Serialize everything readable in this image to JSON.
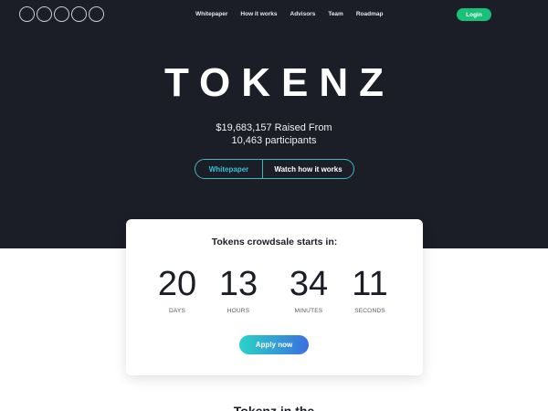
{
  "header": {
    "logo_icon": "five-circles-logo",
    "nav": [
      "Whitepaper",
      "How it works",
      "Advisors",
      "Team",
      "Roadmap"
    ],
    "login_label": "Login"
  },
  "hero": {
    "title": "TOKENZ",
    "raised_line1": "$19,683,157 Raised From",
    "raised_line2": "10,463 participants",
    "cta_whitepaper": "Whitepaper",
    "cta_watch": "Watch how it works"
  },
  "countdown": {
    "title": "Tokens crowdsale starts in:",
    "days": "20",
    "days_label": "DAYS",
    "hours": "13",
    "hours_label": "HOURS",
    "minutes": "34",
    "minutes_label": "MINUTES",
    "seconds": "11",
    "seconds_label": "SECONDS",
    "apply_label": "Apply now"
  },
  "next_section": {
    "heading": "Tokenz in the"
  },
  "colors": {
    "hero_bg": "#1b1d27",
    "login_green": "#18c07a",
    "accent_teal": "#33c2d6",
    "apply_gradient_start": "#28d4c6",
    "apply_gradient_end": "#3b6fe0"
  }
}
